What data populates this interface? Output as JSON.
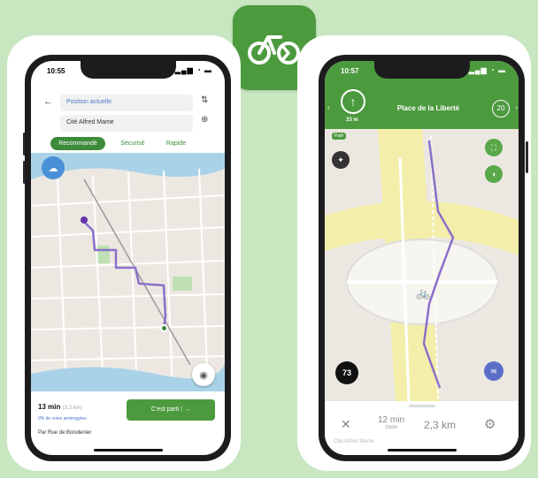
{
  "brand": {
    "icon": "bicycle-route-icon",
    "background_color": "#c8e6c0",
    "accent_color": "#4c9a3e"
  },
  "left_phone": {
    "status_time": "10:55",
    "origin": "Position actuelle",
    "destination": "Cité Alfred Mame",
    "tabs": [
      {
        "label": "Recommandé",
        "active": true
      },
      {
        "label": "Sécurisé",
        "active": false
      },
      {
        "label": "Rapide",
        "active": false
      }
    ],
    "duration": "13 min",
    "distance": "(3,3 km)",
    "protected_note": "0% de voies aménagées",
    "go_button": "C'est parti ! →",
    "via": "Par Rue de Boisdenier"
  },
  "right_phone": {
    "status_time": "10:57",
    "street": "Place de la Liberté",
    "turn_distance": "33 m",
    "speed_limit": "20",
    "path_label": "Path",
    "speed_badge": "73",
    "duration": "12 min",
    "arrival_time": "11h09",
    "distance": "2,3 km",
    "destination_hint": "Cité Alfred Mame"
  }
}
